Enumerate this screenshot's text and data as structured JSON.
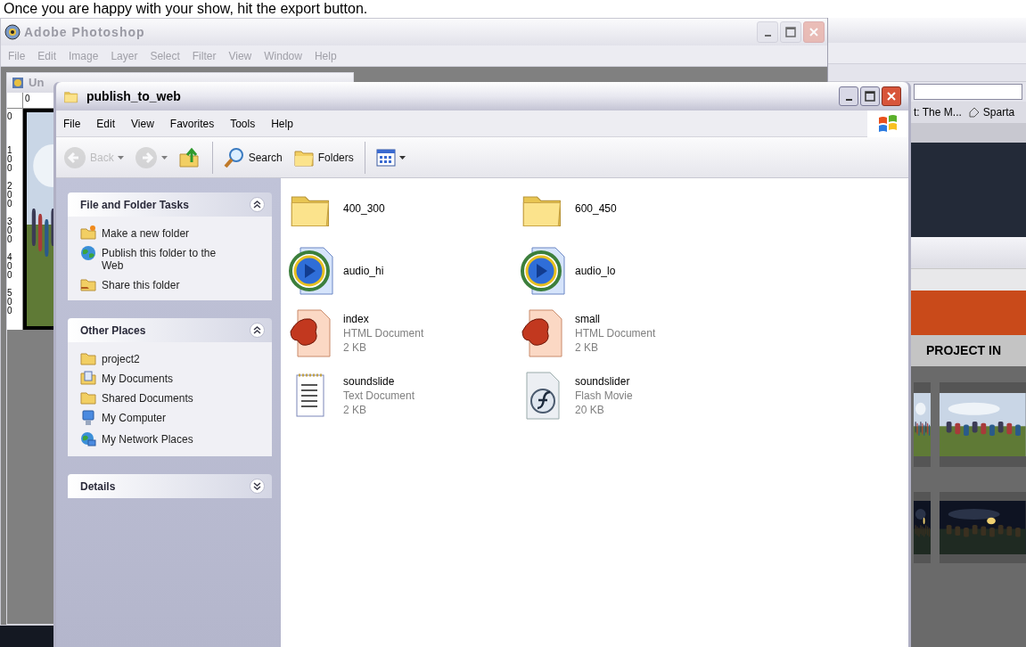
{
  "caption": "Once you are happy with your show, hit the export button.",
  "photoshop": {
    "title": "Adobe Photoshop",
    "menu": [
      "File",
      "Edit",
      "Image",
      "Layer",
      "Select",
      "Filter",
      "View",
      "Window",
      "Help"
    ],
    "document": {
      "title": "Un",
      "top_ruler": "0",
      "left_ruler": [
        "0",
        "100",
        "200",
        "300",
        "400",
        "500"
      ]
    }
  },
  "browser": {
    "links": [
      {
        "kind": "plain",
        "label": "t: The M..."
      },
      {
        "kind": "tag",
        "label": "Sparta"
      }
    ],
    "nav_heading": "PROJECT IN"
  },
  "explorer": {
    "title": "publish_to_web",
    "menu": [
      "File",
      "Edit",
      "View",
      "Favorites",
      "Tools",
      "Help"
    ],
    "toolbar": [
      {
        "kind": "back",
        "label": "Back",
        "disabled": true
      },
      {
        "kind": "forward",
        "disabled": true
      },
      {
        "kind": "up",
        "disabled": false
      },
      {
        "kind": "search",
        "label": "Search",
        "disabled": false
      },
      {
        "kind": "folders",
        "label": "Folders",
        "disabled": false
      },
      {
        "kind": "views",
        "disabled": false
      }
    ],
    "panels": [
      {
        "title": "File and Folder Tasks",
        "expanded": true,
        "items": [
          {
            "kind": "new-folder",
            "label": "Make a new folder"
          },
          {
            "kind": "publish",
            "label": "Publish this folder to the Web"
          },
          {
            "kind": "share",
            "label": "Share this folder"
          }
        ]
      },
      {
        "title": "Other Places",
        "expanded": true,
        "items": [
          {
            "kind": "folder",
            "label": "project2"
          },
          {
            "kind": "documents",
            "label": "My Documents"
          },
          {
            "kind": "folder",
            "label": "Shared Documents"
          },
          {
            "kind": "computer",
            "label": "My Computer"
          },
          {
            "kind": "network",
            "label": "My Network Places"
          }
        ]
      },
      {
        "title": "Details",
        "expanded": false
      }
    ],
    "files": [
      {
        "kind": "folder",
        "name": "400_300"
      },
      {
        "kind": "folder",
        "name": "600_450"
      },
      {
        "kind": "audio",
        "name": "audio_hi"
      },
      {
        "kind": "audio",
        "name": "audio_lo"
      },
      {
        "kind": "html",
        "name": "index",
        "type": "HTML Document",
        "size": "2 KB"
      },
      {
        "kind": "html",
        "name": "small",
        "type": "HTML Document",
        "size": "2 KB"
      },
      {
        "kind": "text",
        "name": "soundslide",
        "type": "Text Document",
        "size": "2 KB"
      },
      {
        "kind": "flash",
        "name": "soundslider",
        "type": "Flash Movie",
        "size": "20 KB"
      }
    ]
  }
}
